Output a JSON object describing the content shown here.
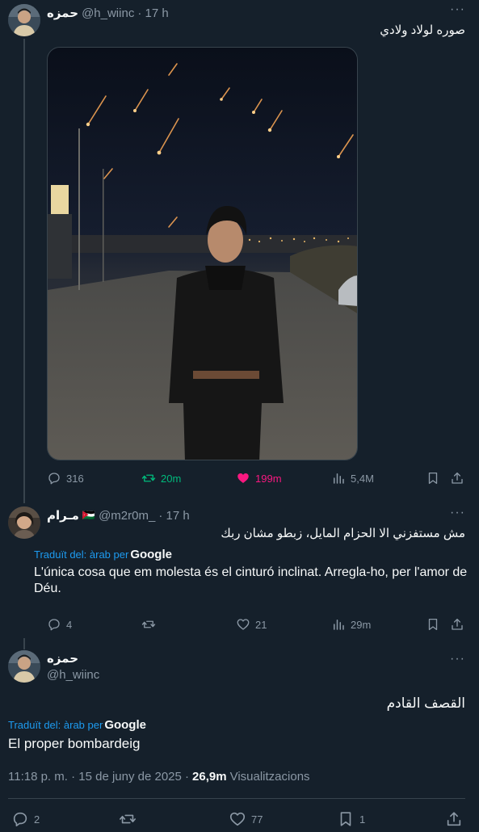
{
  "tweet1": {
    "name": "حمزه",
    "handle": "@h_wiinc",
    "time": "· 17 h",
    "text": "صوره لولاد ولادي",
    "replies": "316",
    "retweets": "20m",
    "likes": "199m",
    "views": "5,4M",
    "retweet_color": "#00ba7c",
    "like_color": "#f91880"
  },
  "tweet2": {
    "name": "مـرام",
    "flag": "🇯🇴",
    "handle": "@m2r0m_",
    "time": "· 17 h",
    "text": "مش مستفزني الا الحزام المايل، زبطو مشان ربك",
    "translated_label": "Traduït del: àrab per",
    "google": "Google",
    "translation": "L'única cosa que em molesta és el cinturó inclinat. Arregla-ho, per l'amor de Déu.",
    "replies": "4",
    "likes": "21",
    "views": "29m"
  },
  "tweet3": {
    "name": "حمزه",
    "handle": "@h_wiinc",
    "text": "القصف القادم",
    "translated_label": "Traduït del: àrab per",
    "google": "Google",
    "translation": "El proper bombardeig",
    "timestamp": "11:18 p. m. · 15 de juny de 2025 ·",
    "views_count": "26,9m",
    "views_label": "Visualitzacions",
    "replies": "2",
    "likes": "77",
    "bookmarks": "1"
  },
  "icons": {
    "more": "more-icon",
    "reply": "reply-icon",
    "retweet": "retweet-icon",
    "like": "heart-icon",
    "views": "views-icon",
    "bookmark": "bookmark-icon",
    "share": "share-icon"
  },
  "colors": {
    "background": "#15202b",
    "link": "#1d9bf0",
    "muted": "#8b98a5"
  }
}
